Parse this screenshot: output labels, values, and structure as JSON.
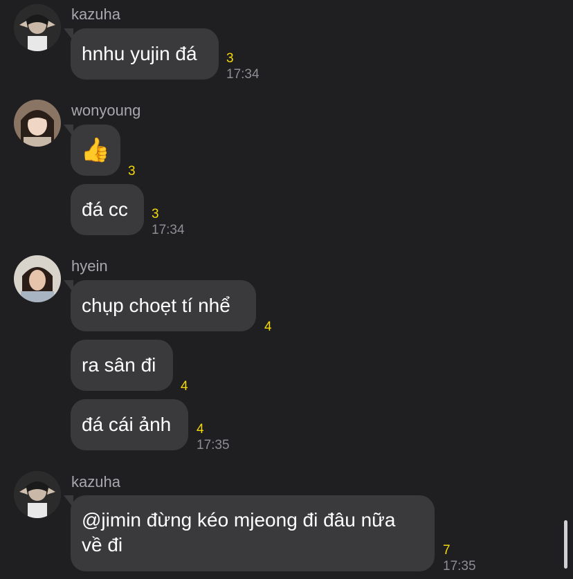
{
  "groups": [
    {
      "sender": "kazuha",
      "avatar_icon": "avatar-kazuha",
      "messages": [
        {
          "text": "hnhu yujin đá",
          "count": "3",
          "time": "17:34"
        }
      ]
    },
    {
      "sender": "wonyoung",
      "avatar_icon": "avatar-wonyoung",
      "messages": [
        {
          "text": "👍",
          "count": "3",
          "time": ""
        },
        {
          "text": "đá cc",
          "count": "3",
          "time": "17:34"
        }
      ]
    },
    {
      "sender": "hyein",
      "avatar_icon": "avatar-hyein",
      "messages": [
        {
          "text": "chụp choẹt tí nhể",
          "count": "4",
          "time": ""
        },
        {
          "text": "ra sân đi",
          "count": "4",
          "time": ""
        },
        {
          "text": "đá cái ảnh",
          "count": "4",
          "time": "17:35"
        }
      ]
    },
    {
      "sender": "kazuha",
      "avatar_icon": "avatar-kazuha",
      "messages": [
        {
          "text_line1": "@jimin đừng kéo mjeong đi đâu nữa",
          "text_line2": "về đi",
          "count": "7",
          "time": "17:35"
        }
      ]
    }
  ],
  "colors": {
    "background": "#1f1f21",
    "bubble": "#3a3a3c",
    "sender": "#a8a8ad",
    "count": "#f5d90a",
    "time": "#8e8e93"
  }
}
